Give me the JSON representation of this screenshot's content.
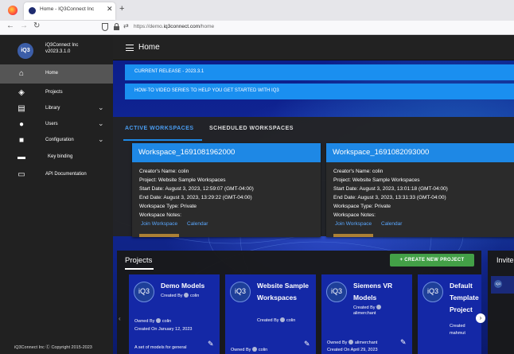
{
  "browser": {
    "tab_title": "Home - IQ3Connect Inc",
    "url_prefix": "https://demo.",
    "url_domain": "iq3connect.com",
    "url_path": "/home"
  },
  "sidebar": {
    "logo_text": "iQ3",
    "company_name": "iQ3Connect Inc",
    "version": "v2023.3.1.0",
    "items": [
      {
        "label": "Home",
        "icon": "home-icon"
      },
      {
        "label": "Projects",
        "icon": "layers-icon"
      },
      {
        "label": "Library",
        "icon": "library-icon"
      },
      {
        "label": "Users",
        "icon": "user-icon"
      },
      {
        "label": "Configuration",
        "icon": "lock-icon"
      },
      {
        "label": "Key binding",
        "icon": "gamepad-icon"
      },
      {
        "label": "API Documentation",
        "icon": "document-icon"
      }
    ],
    "footer": "iQ3Connect Inc Ⓒ Copyright 2015-2023"
  },
  "header": {
    "title": "Home"
  },
  "banners": [
    "CURRENT RELEASE - 2023.3.1",
    "HOW-TO VIDEO SERIES TO HELP YOU GET STARTED WITH IQ3"
  ],
  "workspace_tabs": [
    "ACTIVE WORKSPACES",
    "SCHEDULED WORKSPACES"
  ],
  "workspaces": [
    {
      "name": "Workspace_1691081962000",
      "creator": "Creator's Name: colin",
      "project": "Project: Website Sample Workspaces",
      "start": "Start Date: August 3, 2023, 12:59:07 (GMT-04:00)",
      "end": "End Date: August 3, 2023, 13:29:22 (GMT-04:00)",
      "type": "Workspace Type: Private",
      "notes": "Workspace Notes:",
      "join": "Join Workspace",
      "calendar": "Calendar"
    },
    {
      "name": "Workspace_1691082093000",
      "creator": "Creator's Name: colin",
      "project": "Project: Website Sample Workspaces",
      "start": "Start Date: August 3, 2023, 13:01:18 (GMT-04:00)",
      "end": "End Date: August 3, 2023, 13:31:33 (GMT-04:00)",
      "type": "Workspace Type: Private",
      "notes": "Workspace Notes:",
      "join": "Join Workspace",
      "calendar": "Calendar"
    }
  ],
  "projects_section": {
    "title": "Projects",
    "create_label": "+ CREATE NEW PROJECT",
    "invite_title": "Invite"
  },
  "projects": [
    {
      "logo": "iQ3",
      "name": "Demo Models",
      "created_by": "Created By",
      "creator": "colin",
      "owned_by": "Owned By",
      "owner": "colin",
      "created_on": "Created On January 12, 2023",
      "desc": "A set of models for general"
    },
    {
      "logo": "iQ3",
      "name": "Website Sample Workspaces",
      "created_by": "Created By",
      "creator": "colin",
      "owned_by": "Owned By",
      "owner": "colin"
    },
    {
      "logo": "iQ3",
      "name": "Siemens VR Models",
      "created_by": "Created By",
      "creator": "alimerchant",
      "owned_by": "Owned By",
      "owner": "alimerchant",
      "created_on": "Created On April 29, 2023"
    },
    {
      "logo": "iQ3",
      "name": "Default Template Project",
      "created_by": "Created",
      "creator": "mahmut"
    }
  ]
}
